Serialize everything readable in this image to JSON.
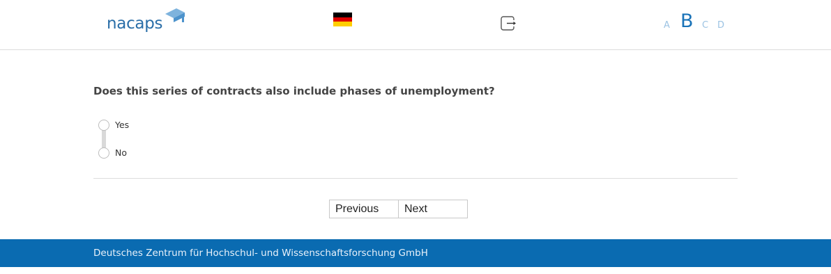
{
  "header": {
    "logo_text": "nacaps",
    "language": "de-flag-icon",
    "font_sizes": [
      "A",
      "B",
      "C",
      "D"
    ]
  },
  "question": {
    "text": "Does this series of contracts also include phases of unemployment?",
    "options": [
      "Yes",
      "No"
    ]
  },
  "nav": {
    "previous_label": "Previous",
    "next_label": "Next"
  },
  "footer": {
    "text": "Deutsches Zentrum für Hochschul- und Wissenschaftsforschung GmbH"
  },
  "colors": {
    "brand": "#0a6bb1",
    "logo": "#2a6ea8"
  }
}
